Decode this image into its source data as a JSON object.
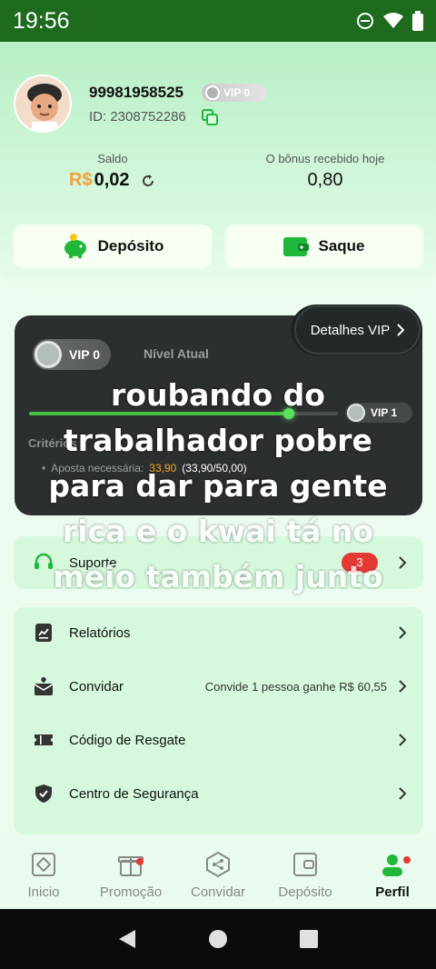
{
  "status_bar": {
    "time": "19:56"
  },
  "profile": {
    "username": "99981958525",
    "vip_badge": "VIP 0",
    "id_text": "ID: 2308752286"
  },
  "balance": {
    "saldo_label": "Saldo",
    "saldo_currency": "R$",
    "saldo_value": "0,02",
    "bonus_label": "O bônus recebido hoje",
    "bonus_value": "0,80"
  },
  "actions": {
    "deposit_label": "Depósito",
    "withdraw_label": "Saque"
  },
  "vip_card": {
    "details_label": "Detalhes VIP",
    "current_vip": "VIP 0",
    "current_level_label": "Nível Atual",
    "next_vip": "VIP 1",
    "criteria_label": "Critérios",
    "bet_required_label": "Aposta necessária:",
    "bet_current": "33,90",
    "bet_progress_text": "(33,90/50,00)",
    "progress_fraction": 0.678
  },
  "caption": {
    "line1": "roubando do",
    "line2": "trabalhador pobre",
    "line3": "para dar para gente",
    "line4": "rica e o kwai tá no",
    "line5": "meio também junto"
  },
  "menu": {
    "support": {
      "label": "Suporte",
      "badge": "3"
    },
    "reports": {
      "label": "Relatórios"
    },
    "invite": {
      "label": "Convidar",
      "extra": "Convide 1 pessoa ganhe R$ 60,55"
    },
    "redeem": {
      "label": "Código de Resgate"
    },
    "security": {
      "label": "Centro de Segurança"
    }
  },
  "tabs": [
    {
      "label": "Inicio"
    },
    {
      "label": "Promoção"
    },
    {
      "label": "Convidar"
    },
    {
      "label": "Depósito"
    },
    {
      "label": "Perfil"
    }
  ],
  "colors": {
    "accent_green": "#1fb83a",
    "status_bar": "#1e6b1e",
    "badge_red": "#e53935"
  },
  "icons": [
    "minus-circle-icon",
    "wifi-icon",
    "battery-icon",
    "copy-icon",
    "refresh-icon",
    "piggy-bank-icon",
    "wallet-icon",
    "chevron-right-icon",
    "headset-icon",
    "report-icon",
    "invite-icon",
    "ticket-icon",
    "shield-icon",
    "home-icon",
    "gift-icon",
    "share-icon",
    "deposit-icon",
    "profile-icon",
    "back-icon",
    "home-circle-icon",
    "recents-icon"
  ]
}
